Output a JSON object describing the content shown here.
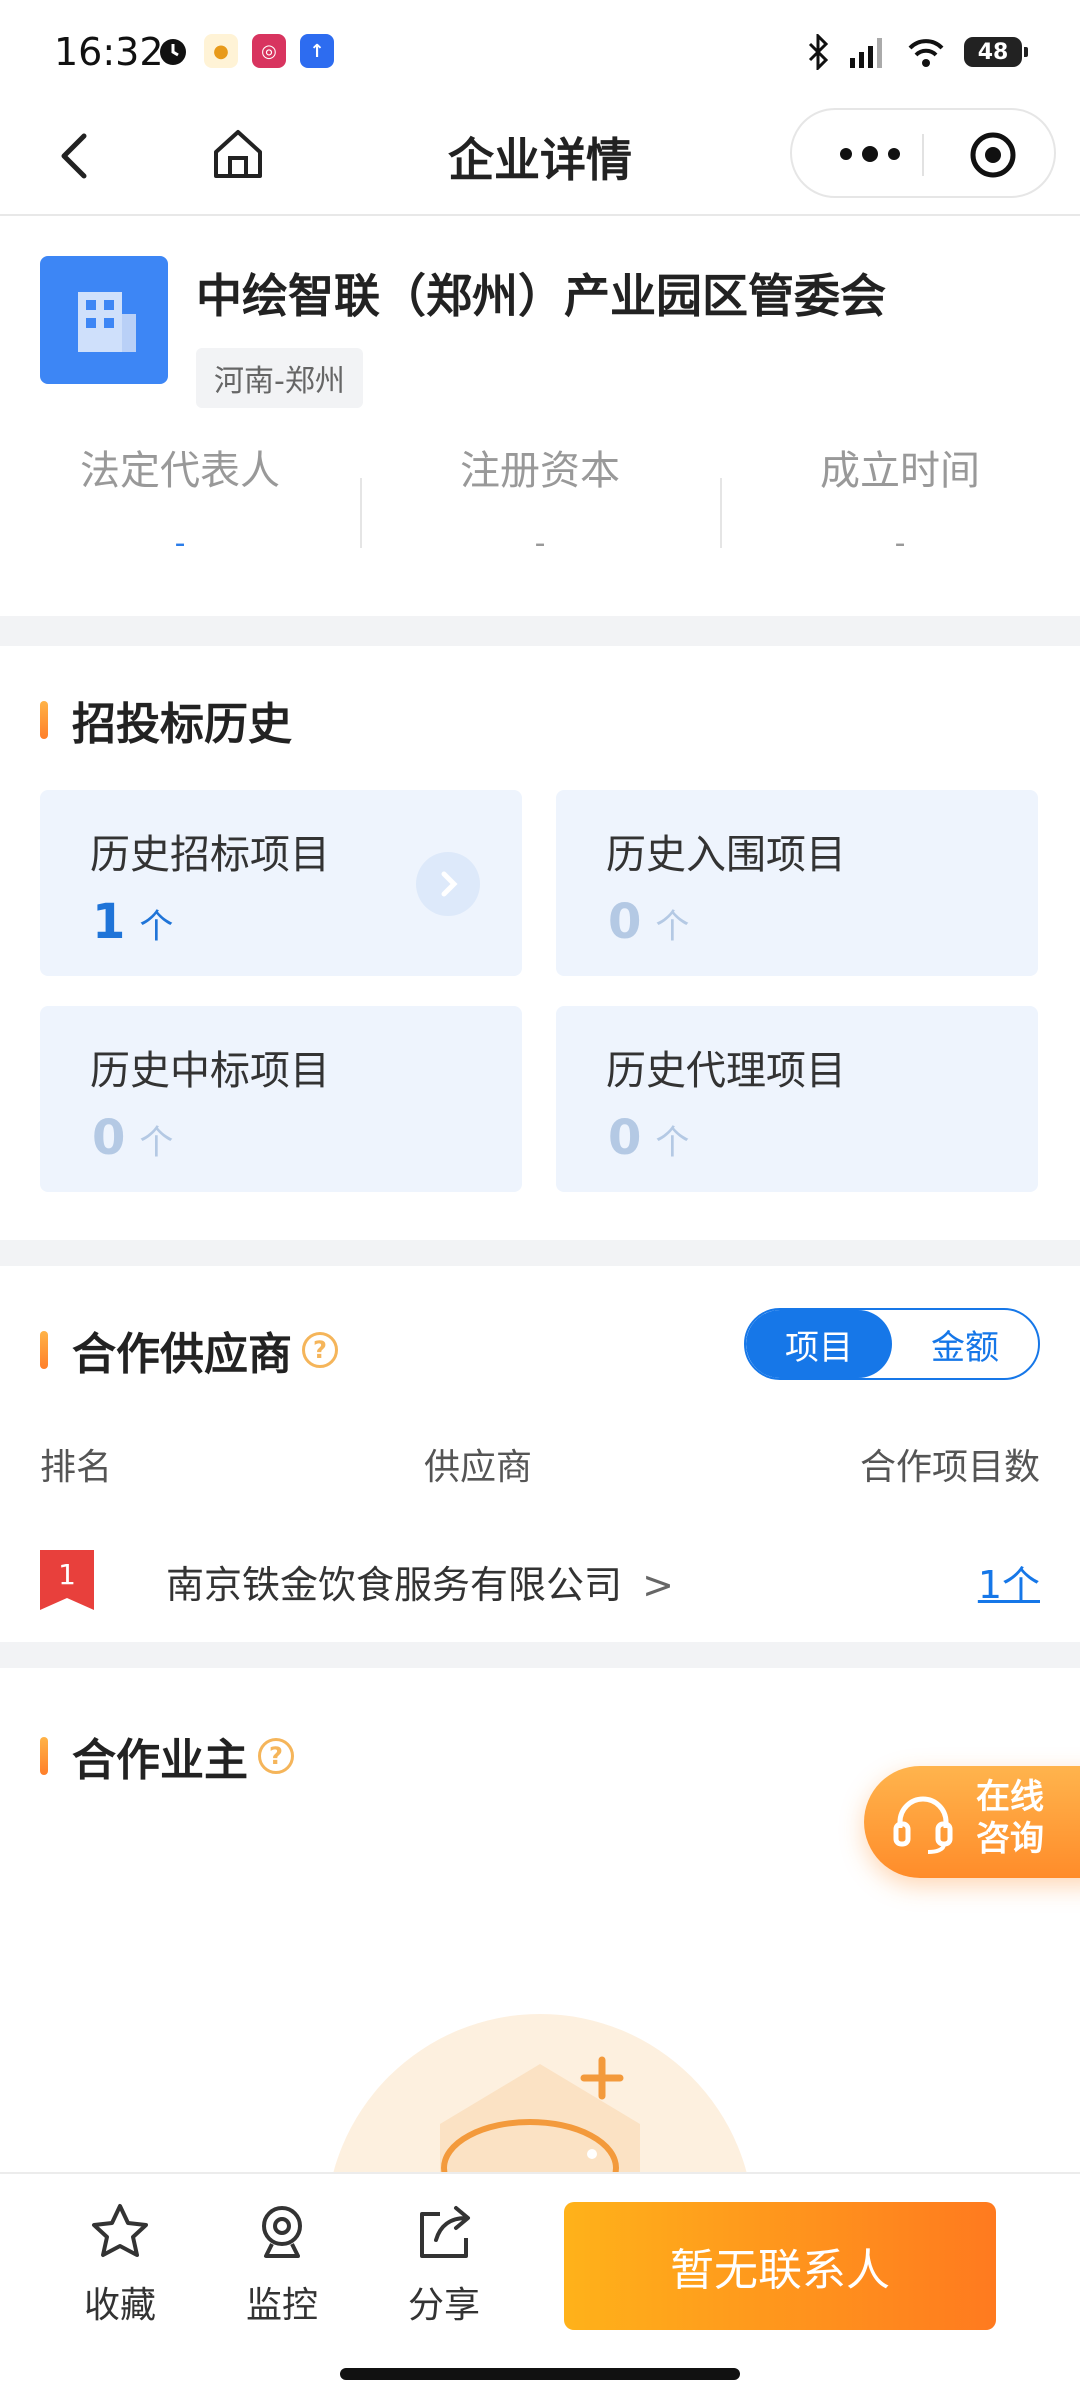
{
  "status_bar": {
    "time": "16:32",
    "battery": "48"
  },
  "nav": {
    "title": "企业详情"
  },
  "company": {
    "name": "中绘智联（郑州）产业园区管委会",
    "region": "河南-郑州",
    "stats": [
      {
        "label": "法定代表人",
        "value": "-"
      },
      {
        "label": "注册资本",
        "value": "-"
      },
      {
        "label": "成立时间",
        "value": "-"
      }
    ]
  },
  "bidding": {
    "title": "招投标历史",
    "unit": "个",
    "cards": [
      {
        "label": "历史招标项目",
        "count": "1"
      },
      {
        "label": "历史入围项目",
        "count": "0"
      },
      {
        "label": "历史中标项目",
        "count": "0"
      },
      {
        "label": "历史代理项目",
        "count": "0"
      }
    ]
  },
  "suppliers": {
    "title": "合作供应商",
    "help": "?",
    "toggle": {
      "active": "项目",
      "inactive": "金额"
    },
    "headers": {
      "rank": "排名",
      "supplier": "供应商",
      "count": "合作项目数"
    },
    "rows": [
      {
        "rank": "1",
        "name": "南京铁金饮食服务有限公司",
        "chevron": ">",
        "count": "1个"
      }
    ]
  },
  "owners": {
    "title": "合作业主",
    "help": "?"
  },
  "consult": {
    "line1": "在线",
    "line2": "咨询"
  },
  "bottom_bar": {
    "favorite": "收藏",
    "monitor": "监控",
    "share": "分享",
    "contact": "暂无联系人"
  },
  "colors": {
    "primary_blue": "#1677e8",
    "accent_orange": "#ff8c2a"
  }
}
